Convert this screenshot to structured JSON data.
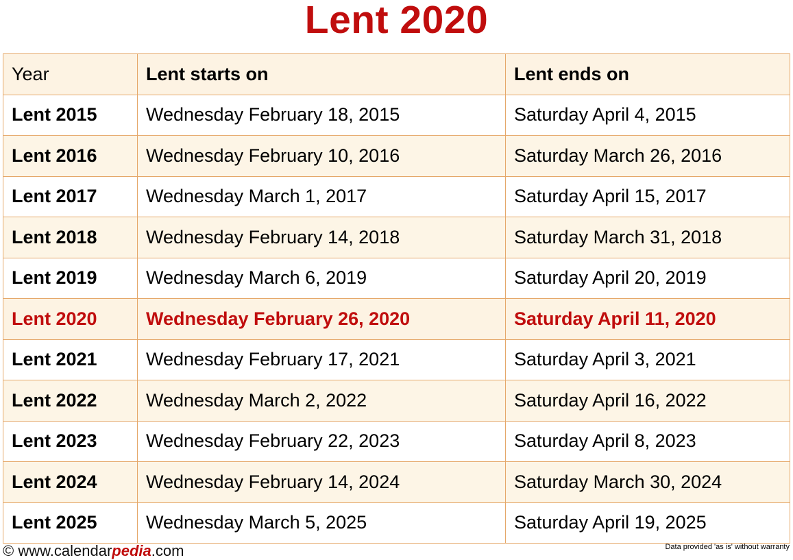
{
  "title": "Lent 2020",
  "accent_colors": {
    "title_red": "#C00D0D",
    "highlight_red": "#C00D0D",
    "border_orange": "#E5A86A",
    "row_cream": "#FDF5E6",
    "header_cream": "#FDF3E3",
    "row_white": "#FFFFFF"
  },
  "table": {
    "columns": [
      {
        "key": "year",
        "header": "Year"
      },
      {
        "key": "start",
        "header": "Lent starts on"
      },
      {
        "key": "end",
        "header": "Lent ends on"
      }
    ],
    "rows": [
      {
        "year": "Lent 2015",
        "start": "Wednesday February 18, 2015",
        "end": "Saturday April 4, 2015",
        "shade": "white",
        "highlight": false
      },
      {
        "year": "Lent 2016",
        "start": "Wednesday February 10, 2016",
        "end": "Saturday March 26, 2016",
        "shade": "cream",
        "highlight": false
      },
      {
        "year": "Lent 2017",
        "start": "Wednesday March 1, 2017",
        "end": "Saturday April 15, 2017",
        "shade": "white",
        "highlight": false
      },
      {
        "year": "Lent 2018",
        "start": "Wednesday February 14, 2018",
        "end": "Saturday March 31, 2018",
        "shade": "cream",
        "highlight": false
      },
      {
        "year": "Lent 2019",
        "start": "Wednesday March 6, 2019",
        "end": "Saturday April 20, 2019",
        "shade": "white",
        "highlight": false
      },
      {
        "year": "Lent 2020",
        "start": "Wednesday February 26, 2020",
        "end": "Saturday April 11, 2020",
        "shade": "highlight",
        "highlight": true
      },
      {
        "year": "Lent 2021",
        "start": "Wednesday February 17, 2021",
        "end": "Saturday April 3, 2021",
        "shade": "white",
        "highlight": false
      },
      {
        "year": "Lent 2022",
        "start": "Wednesday March 2, 2022",
        "end": "Saturday April 16, 2022",
        "shade": "cream",
        "highlight": false
      },
      {
        "year": "Lent 2023",
        "start": "Wednesday February 22, 2023",
        "end": "Saturday April 8, 2023",
        "shade": "white",
        "highlight": false
      },
      {
        "year": "Lent 2024",
        "start": "Wednesday February 14, 2024",
        "end": "Saturday March 30, 2024",
        "shade": "cream",
        "highlight": false
      },
      {
        "year": "Lent 2025",
        "start": "Wednesday March 5, 2025",
        "end": "Saturday April 19, 2025",
        "shade": "white",
        "highlight": false
      }
    ]
  },
  "footer": {
    "copyright_prefix": "© www.calendar",
    "copyright_brand": "pedia",
    "copyright_suffix": ".com",
    "disclaimer": "Data provided 'as is' without warranty"
  }
}
